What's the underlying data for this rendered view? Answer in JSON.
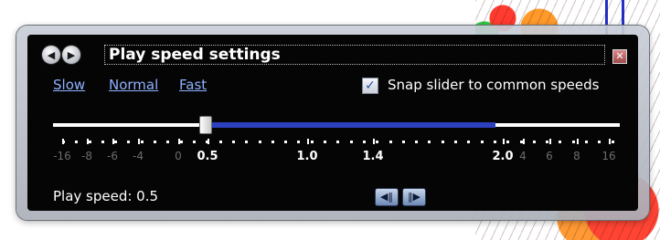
{
  "window": {
    "title": "Play speed settings",
    "back_icon": "back-arrow-icon",
    "forward_icon": "forward-arrow-icon",
    "close_icon": "close-icon"
  },
  "presets": [
    {
      "label": "Slow"
    },
    {
      "label": "Normal"
    },
    {
      "label": "Fast"
    }
  ],
  "snap": {
    "label": "Snap slider to common speeds",
    "checked": true
  },
  "slider": {
    "value": 0.5,
    "scale_labels": [
      "-16",
      "-8",
      "-6",
      "-4",
      "0",
      "0.5",
      "1.0",
      "1.4",
      "2.0",
      "4",
      "6",
      "8",
      "16"
    ],
    "highlighted_labels": [
      "0.5",
      "1.0",
      "1.4",
      "2.0"
    ],
    "fill_end_label": "2.0",
    "accent_color": "#2c3fbf"
  },
  "status": {
    "text": "Play speed: 0.5"
  },
  "step_buttons": {
    "back_icon": "step-backward-icon",
    "forward_icon": "step-forward-icon"
  }
}
